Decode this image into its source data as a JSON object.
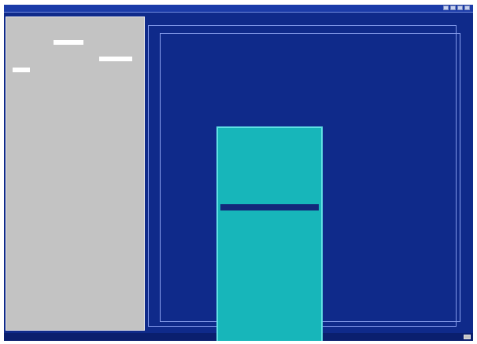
{
  "window": {
    "title": ""
  },
  "help_panel": {
    "lines": [
      "",
      "",
      "",
      "",
      "",
      "",
      ""
    ]
  },
  "main": {
    "title": "",
    "fields": [
      "",
      "",
      "",
      "",
      "",
      "",
      "",
      ""
    ],
    "footer_text": "",
    "bottom_left_text": ""
  },
  "menu": {
    "selected_index": 11,
    "items": [
      "",
      "",
      "",
      "",
      "",
      "",
      "",
      "",
      "",
      "",
      "",
      "",
      "",
      "",
      "",
      "",
      "",
      "",
      "",
      "",
      "",
      "",
      "",
      "",
      "",
      "",
      "",
      "",
      "",
      "",
      "",
      "",
      ""
    ]
  },
  "status_bar": {
    "left_text": "",
    "center_text": "",
    "right_text": ""
  },
  "colors": {
    "background": "#0f2a8a",
    "help_panel": "#c3c3c3",
    "menu_bg": "#17b6ba",
    "menu_selected": "#13277a",
    "frame_line": "#7f96e8"
  }
}
